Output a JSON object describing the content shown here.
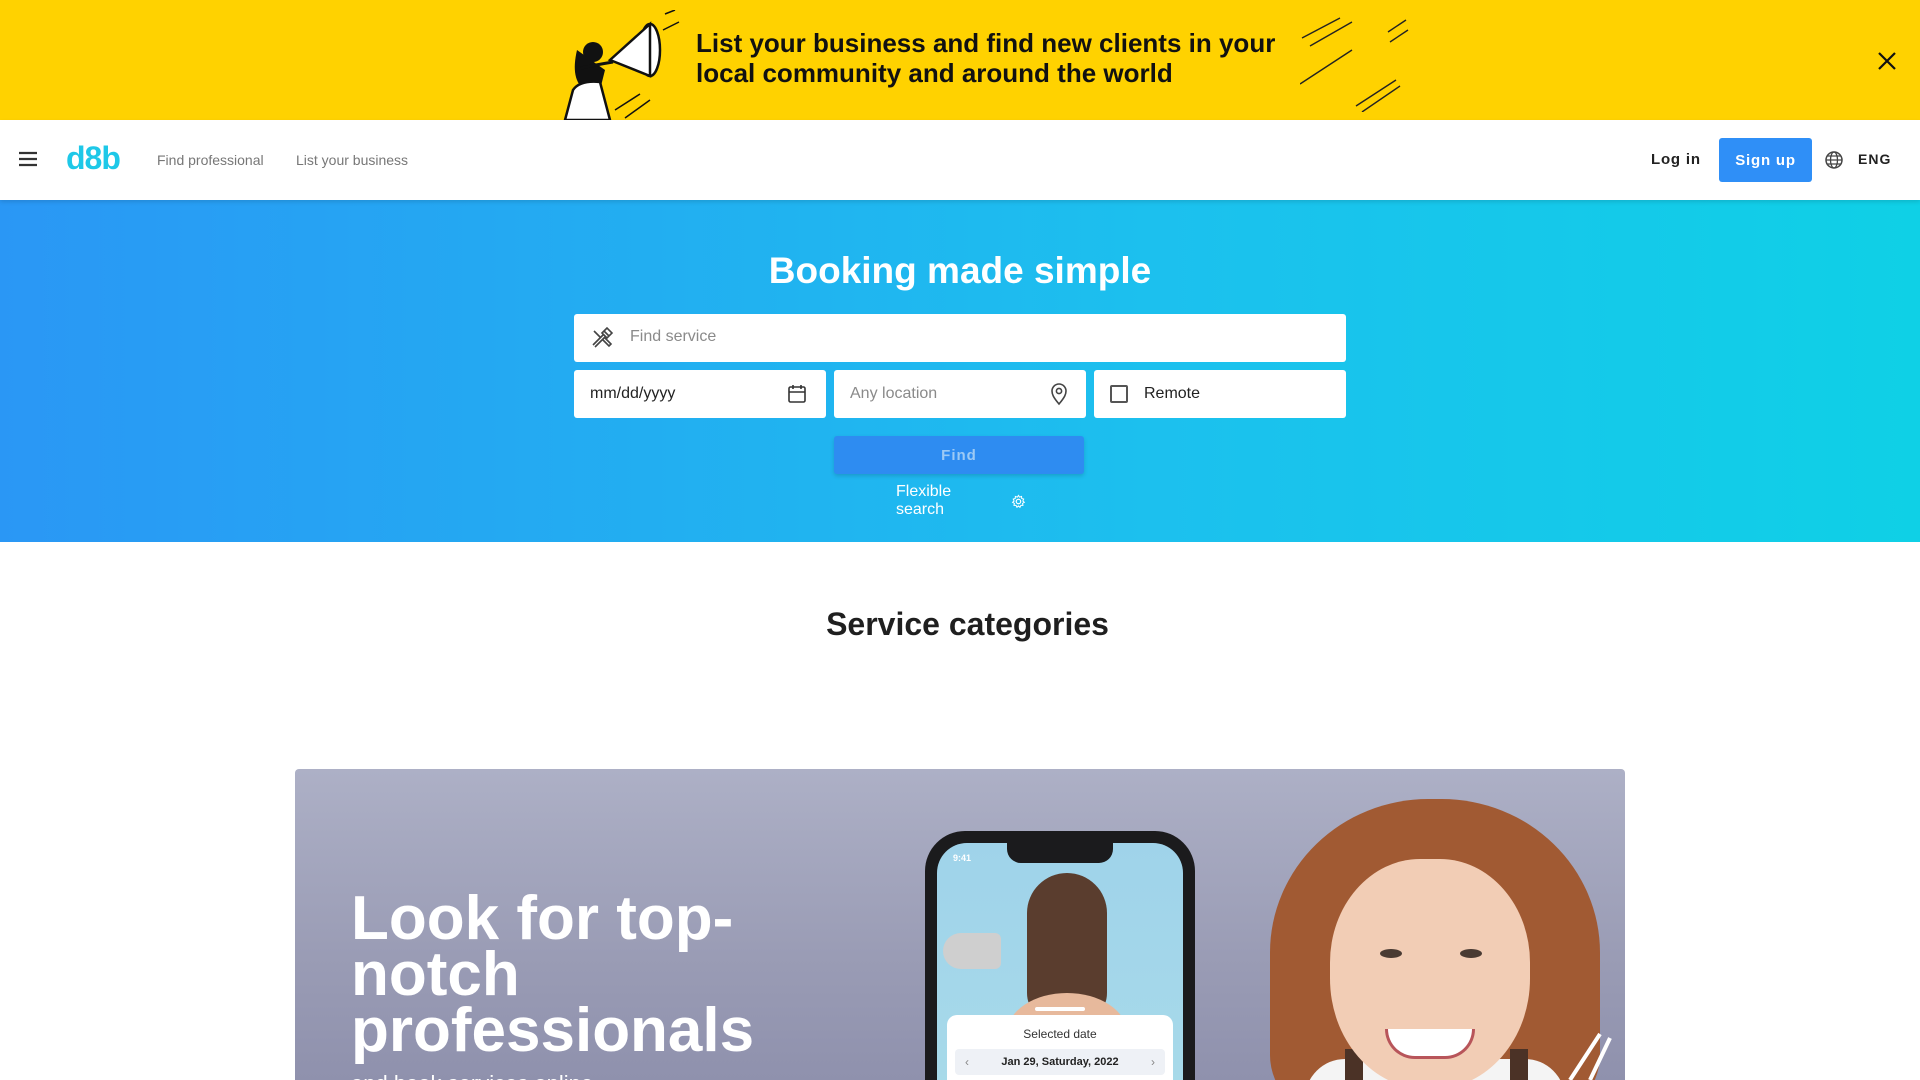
{
  "promo_banner": {
    "text": "List your business and find new clients in your local community and around the world",
    "close_icon": "close-icon",
    "background": "#ffd200"
  },
  "navbar": {
    "menu_icon": "hamburger-menu-icon",
    "logo": "d8b",
    "links": [
      "Find professional",
      "List your business"
    ],
    "login_label": "Log in",
    "signup_label": "Sign up",
    "language_icon": "globe-icon",
    "language": "ENG",
    "accent": "#2f8ff7"
  },
  "hero": {
    "title": "Booking made simple",
    "service_placeholder": "Find service",
    "service_icon": "tools-icon",
    "date_value": "mm/dd/yyyy",
    "calendar_icon": "calendar-icon",
    "location_placeholder": "Any location",
    "location_icon": "location-pin-icon",
    "remote_label": "Remote",
    "remote_checked": false,
    "find_label": "Find",
    "flexible_label": "Flexible search",
    "flexible_icon": "settings-gear-icon"
  },
  "categories": {
    "title": "Service categories"
  },
  "promo_card": {
    "title": "Look for top-notch professionals",
    "subtitle": "and book services online",
    "phone": {
      "time": "9:41",
      "selected_date_label": "Selected date",
      "selected_date": "Jan 29, Saturday, 2022",
      "prev_icon": "chevron-left-icon",
      "next_icon": "chevron-right-icon"
    }
  }
}
